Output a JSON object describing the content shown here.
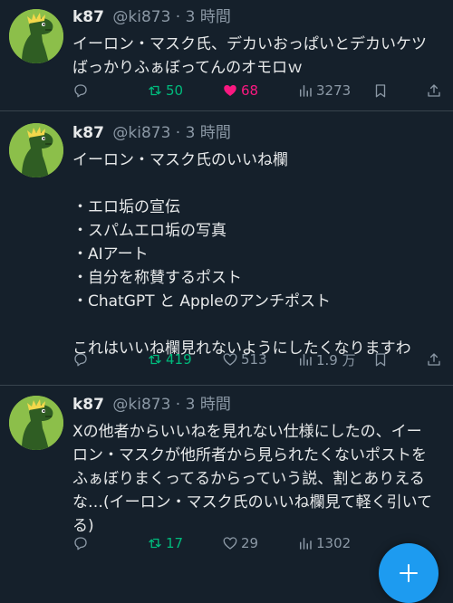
{
  "tweets": [
    {
      "author": {
        "name": "k87",
        "handle": "@ki873",
        "separator": "·",
        "time": "3 時間",
        "avatar_icon": "dinosaur-avatar-icon"
      },
      "lines": [
        "イーロン・マスク氏、デカいおっぱいとデカいケツ",
        "ばっかりふぁぼってんのオモロｗ"
      ],
      "stats": {
        "retweets": "50",
        "likes": "68",
        "views": "3273",
        "liked": true
      }
    },
    {
      "author": {
        "name": "k87",
        "handle": "@ki873",
        "separator": "·",
        "time": "3 時間",
        "avatar_icon": "dinosaur-avatar-icon"
      },
      "lines": [
        "イーロン・マスク氏のいいね欄",
        "",
        "・エロ垢の宣伝",
        "・スパムエロ垢の写真",
        "・AIアート",
        "・自分を称賛するポスト",
        "・ChatGPT と Appleのアンチポスト",
        "",
        "これはいいね欄見れないようにしたくなりますわ"
      ],
      "stats": {
        "retweets": "419",
        "likes": "513",
        "views": "1.9 万",
        "liked": false
      }
    },
    {
      "author": {
        "name": "k87",
        "handle": "@ki873",
        "separator": "·",
        "time": "3 時間",
        "avatar_icon": "dinosaur-avatar-icon"
      },
      "lines": [
        "Xの他者からいいねを見れない仕様にしたの、イー",
        "ロン・マスクが他所者から見られたくないポストを",
        "ふぁぼりまくってるからっていう説、割とありえる",
        "な…(イーロン・マスク氏のいいね欄見て軽く引いて",
        "る)"
      ],
      "stats": {
        "retweets": "17",
        "likes": "29",
        "views": "1302",
        "liked": false
      }
    }
  ],
  "colors": {
    "background": "#15202b",
    "text": "#e7e9ea",
    "muted": "#8b98a5",
    "retweet_active": "#00ba7c",
    "like_active": "#f91880",
    "accent": "#1d9bf0",
    "divider": "#38444d"
  },
  "compose_button": {
    "icon": "plus-icon"
  }
}
